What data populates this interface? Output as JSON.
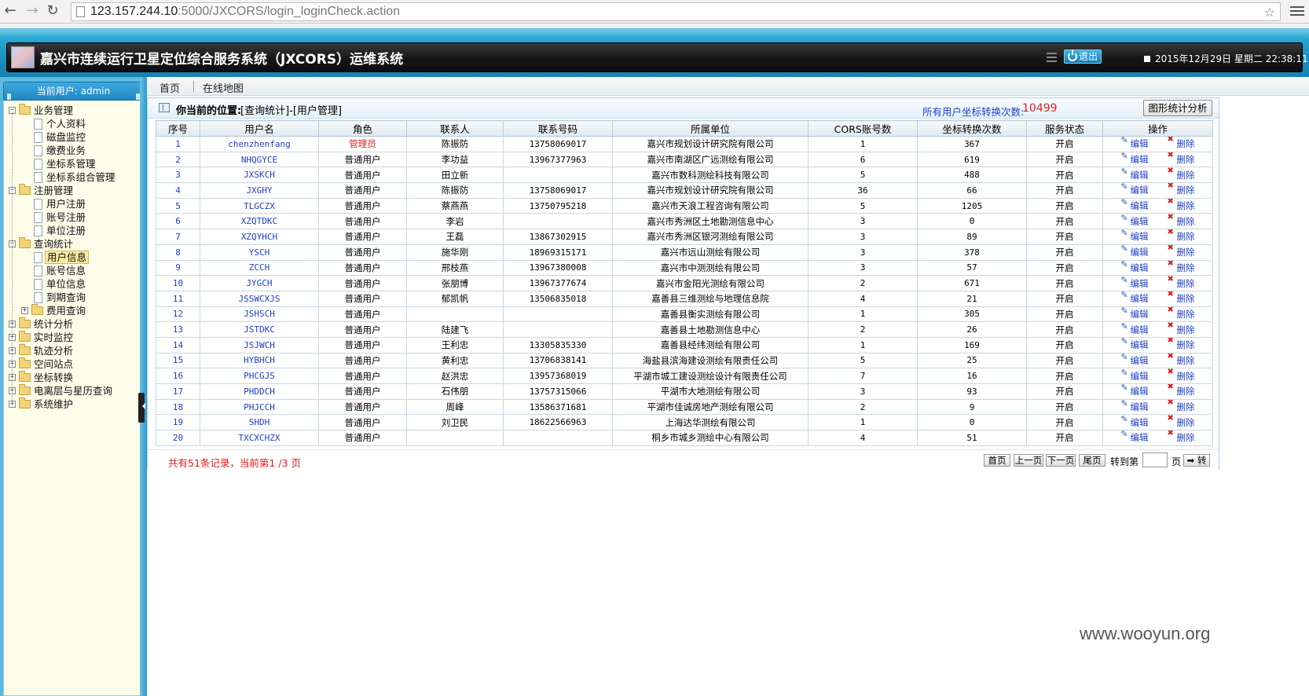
{
  "browser": {
    "url_host": "123.157.244.10",
    "url_rest": ":5000/JXCORS/login_loginCheck.action"
  },
  "header": {
    "title": "嘉兴市连续运行卫星定位综合服务系统（JXCORS）运维系统",
    "logout_label": "退出",
    "datetime": "2015年12月29日 星期二 22:38:11"
  },
  "sidebar": {
    "current_user": "当前用户: admin",
    "tree": [
      {
        "label": "业务管理",
        "type": "folder",
        "expanded": true
      },
      {
        "label": "个人资料",
        "type": "leaf"
      },
      {
        "label": "磁盘监控",
        "type": "leaf"
      },
      {
        "label": "缴费业务",
        "type": "leaf"
      },
      {
        "label": "坐标系管理",
        "type": "leaf"
      },
      {
        "label": "坐标系组合管理",
        "type": "leaf"
      },
      {
        "label": "注册管理",
        "type": "folder",
        "expanded": true
      },
      {
        "label": "用户注册",
        "type": "leaf"
      },
      {
        "label": "账号注册",
        "type": "leaf"
      },
      {
        "label": "单位注册",
        "type": "leaf"
      },
      {
        "label": "查询统计",
        "type": "folder",
        "expanded": true
      },
      {
        "label": "用户信息",
        "type": "leaf",
        "active": true
      },
      {
        "label": "账号信息",
        "type": "leaf"
      },
      {
        "label": "单位信息",
        "type": "leaf"
      },
      {
        "label": "到期查询",
        "type": "leaf"
      },
      {
        "label": "费用查询",
        "type": "subfolder"
      },
      {
        "label": "统计分析",
        "type": "folder"
      },
      {
        "label": "实时监控",
        "type": "folder"
      },
      {
        "label": "轨迹分析",
        "type": "folder"
      },
      {
        "label": "空间站点",
        "type": "folder"
      },
      {
        "label": "坐标转换",
        "type": "folder"
      },
      {
        "label": "电离层与星历查询",
        "type": "folder"
      },
      {
        "label": "系统维护",
        "type": "folder"
      }
    ]
  },
  "main": {
    "tabs": [
      "首页",
      "在线地图"
    ],
    "breadcrumb_label": "你当前的位置:",
    "breadcrumb_path": "[查询统计]-[用户管理]",
    "total_label": "所有用户坐标转换次数:",
    "total_value": "10499",
    "chart_button": "图形统计分析"
  },
  "table": {
    "columns": [
      "序号",
      "用户名",
      "角色",
      "联系人",
      "联系号码",
      "所属单位",
      "CORS账号数",
      "坐标转换次数",
      "服务状态",
      "操作"
    ],
    "edit_label": "编辑",
    "delete_label": "删除",
    "rows": [
      [
        "1",
        "chenzhenfang",
        "管理员",
        "陈振防",
        "13758069017",
        "嘉兴市规划设计研究院有限公司",
        "1",
        "367",
        "开启"
      ],
      [
        "2",
        "NHQGYCE",
        "普通用户",
        "李功益",
        "13967377963",
        "嘉兴市南湖区广远测绘有限公司",
        "6",
        "619",
        "开启"
      ],
      [
        "3",
        "JXSKCH",
        "普通用户",
        "田立新",
        "",
        "嘉兴市数科测绘科技有限公司",
        "5",
        "488",
        "开启"
      ],
      [
        "4",
        "JXGHY",
        "普通用户",
        "陈振防",
        "13758069017",
        "嘉兴市规划设计研究院有限公司",
        "36",
        "66",
        "开启"
      ],
      [
        "5",
        "TLGCZX",
        "普通用户",
        "蔡燕燕",
        "13750795218",
        "嘉兴市天浪工程咨询有限公司",
        "5",
        "1205",
        "开启"
      ],
      [
        "6",
        "XZQTDKC",
        "普通用户",
        "李岩",
        "",
        "嘉兴市秀洲区土地勘测信息中心",
        "3",
        "0",
        "开启"
      ],
      [
        "7",
        "XZQYHCH",
        "普通用户",
        "王磊",
        "13867302915",
        "嘉兴市秀洲区银河测绘有限公司",
        "3",
        "89",
        "开启"
      ],
      [
        "8",
        "YSCH",
        "普通用户",
        "施华刚",
        "18969315171",
        "嘉兴市远山测绘有限公司",
        "3",
        "378",
        "开启"
      ],
      [
        "9",
        "ZCCH",
        "普通用户",
        "邢枝燕",
        "13967380008",
        "嘉兴市中测测绘有限公司",
        "3",
        "57",
        "开启"
      ],
      [
        "10",
        "JYGCH",
        "普通用户",
        "张朋博",
        "13967377674",
        "嘉兴市金阳光测绘有限公司",
        "2",
        "671",
        "开启"
      ],
      [
        "11",
        "JSSWCXJS",
        "普通用户",
        "郁凯帆",
        "13506835018",
        "嘉善县三维测绘与地理信息院",
        "4",
        "21",
        "开启"
      ],
      [
        "12",
        "JSHSCH",
        "普通用户",
        "",
        "",
        "嘉善县衡实测绘有限公司",
        "1",
        "305",
        "开启"
      ],
      [
        "13",
        "JSTDKC",
        "普通用户",
        "陆建飞",
        "",
        "嘉善县土地勘测信息中心",
        "2",
        "26",
        "开启"
      ],
      [
        "14",
        "JSJWCH",
        "普通用户",
        "王利忠",
        "13305835330",
        "嘉善县经纬测绘有限公司",
        "1",
        "169",
        "开启"
      ],
      [
        "15",
        "HYBHCH",
        "普通用户",
        "黄利忠",
        "13706838141",
        "海盐县滨海建设测绘有限责任公司",
        "5",
        "25",
        "开启"
      ],
      [
        "16",
        "PHCGJS",
        "普通用户",
        "赵洪忠",
        "13957368019",
        "平湖市城工建设测绘设计有限责任公司",
        "7",
        "16",
        "开启"
      ],
      [
        "17",
        "PHDDCH",
        "普通用户",
        "石伟朋",
        "13757315066",
        "平湖市大地测绘有限公司",
        "3",
        "93",
        "开启"
      ],
      [
        "18",
        "PHJCCH",
        "普通用户",
        "周峰",
        "13586371681",
        "平湖市佳诚房地产测绘有限公司",
        "2",
        "9",
        "开启"
      ],
      [
        "19",
        "SHDH",
        "普通用户",
        "刘卫民",
        "18622566963",
        "上海达华测绘有限公司",
        "1",
        "0",
        "开启"
      ],
      [
        "20",
        "TXCXCHZX",
        "普通用户",
        "",
        "",
        "桐乡市城乡测绘中心有限公司",
        "4",
        "51",
        "开启"
      ]
    ]
  },
  "pager": {
    "info": "共有51条记录，当前第1 /3 页",
    "first": "首页",
    "prev": "上一页",
    "next": "下一页",
    "last": "尾页",
    "goto_label": "转到第",
    "page_label": "页",
    "go": "➡ 转"
  },
  "watermark": "www.wooyun.org"
}
